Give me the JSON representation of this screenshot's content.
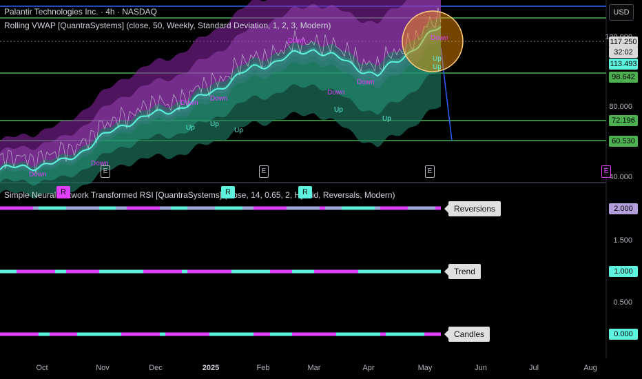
{
  "header": {
    "title": "Palantir Technologies Inc. · 4h · NASDAQ",
    "indicator_top": "Rolling VWAP [QuantraSystems] (close, 50, Weekly, Standard Deviation, 1, 2, 3, Modern)",
    "indicator_bottom": "Simple Neural Network Transformed RSI [QuantraSystems] (close, 14, 0.65, 2, Hybrid, Reversals, Modern)",
    "currency_button": "USD"
  },
  "price_axis": {
    "ticks": [
      "120.000",
      "80.000",
      "40.000"
    ],
    "tags": [
      {
        "label": "117.250",
        "color": "#d9d9d9"
      },
      {
        "label": "32:02",
        "color": "#d9d9d9"
      },
      {
        "label": "113.493",
        "color": "#5ef3df"
      },
      {
        "label": "98.642",
        "color": "#4caf50"
      },
      {
        "label": "72.196",
        "color": "#4caf50"
      },
      {
        "label": "60.530",
        "color": "#4caf50"
      }
    ]
  },
  "rsi_axis": {
    "ticks": [
      "1.500",
      "0.500"
    ],
    "tags": [
      {
        "label": "2.000",
        "color": "#b39ddb"
      },
      {
        "label": "1.000",
        "color": "#5ef3df"
      },
      {
        "label": "0.000",
        "color": "#5ef3df"
      }
    ]
  },
  "rows": [
    {
      "label": "Reversions"
    },
    {
      "label": "Trend"
    },
    {
      "label": "Candles"
    }
  ],
  "time_axis": [
    "Oct",
    "Nov",
    "Dec",
    "2025",
    "Feb",
    "Mar",
    "Apr",
    "May",
    "Jun",
    "Jul",
    "Aug"
  ],
  "signals": {
    "down_label": "Down",
    "up_label": "Up",
    "earnings_label": "E",
    "reversal_label": "R"
  },
  "colors": {
    "background": "#000000",
    "vwap_line": "#5ef3df",
    "band_bull": "#1f7a63",
    "band_bear": "#8e24aa",
    "bear_signal": "#e040fb",
    "bull_signal": "#5ef3df",
    "horizontal_line": "#4caf50",
    "top_line": "#2962ff"
  },
  "chart_data": [
    {
      "type": "line",
      "title": "Palantir Technologies Inc. · 4h · NASDAQ",
      "x": [
        "Oct",
        "Nov",
        "Dec",
        "2025",
        "Feb",
        "Mar",
        "Apr",
        "May"
      ],
      "series": [
        {
          "name": "Rolling VWAP",
          "values": [
            36,
            40,
            62,
            72,
            92,
            103,
            88,
            115
          ]
        }
      ],
      "horizontal_levels": [
        117.25,
        113.493,
        98.642,
        72.196,
        60.53
      ],
      "ylim": [
        30,
        130
      ],
      "y_ticks": [
        40,
        80,
        120
      ],
      "grid": false
    },
    {
      "type": "scatter",
      "title": "Simple Neural Network Transformed RSI",
      "categories": [
        "Reversions",
        "Trend",
        "Candles"
      ],
      "values": [
        2.0,
        1.0,
        0.0
      ],
      "ylim": [
        0,
        2
      ],
      "y_ticks": [
        0.5,
        1.5
      ]
    }
  ]
}
